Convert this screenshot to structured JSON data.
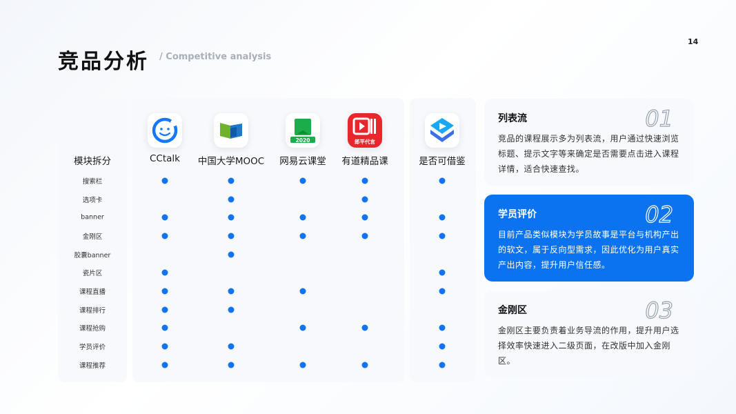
{
  "page_number": "14",
  "title": "竞品分析",
  "subtitle": "/ Competitive analysis",
  "row_header": "模块拆分",
  "columns": [
    {
      "label": "CCtalk",
      "icon": "cctalk-icon"
    },
    {
      "label": "中国大学MOOC",
      "icon": "mooc-icon"
    },
    {
      "label": "网易云课堂",
      "icon": "netease-study-icon",
      "badge": "2020"
    },
    {
      "label": "有道精品课",
      "icon": "youdao-icon",
      "badge": "郎平代言"
    },
    {
      "label": "是否可借鉴",
      "icon": "reference-app-icon"
    }
  ],
  "rows": [
    {
      "label": "搜索栏",
      "marks": [
        true,
        true,
        true,
        true,
        true
      ]
    },
    {
      "label": "选项卡",
      "marks": [
        false,
        true,
        false,
        true,
        false
      ]
    },
    {
      "label": "banner",
      "marks": [
        true,
        true,
        true,
        true,
        true
      ]
    },
    {
      "label": "金刚区",
      "marks": [
        true,
        true,
        true,
        true,
        true
      ]
    },
    {
      "label": "胶囊banner",
      "marks": [
        false,
        true,
        false,
        false,
        false
      ]
    },
    {
      "label": "瓷片区",
      "marks": [
        true,
        false,
        false,
        false,
        true
      ]
    },
    {
      "label": "课程直播",
      "marks": [
        true,
        true,
        true,
        false,
        true
      ]
    },
    {
      "label": "课程排行",
      "marks": [
        true,
        true,
        false,
        false,
        false
      ]
    },
    {
      "label": "课程抢购",
      "marks": [
        true,
        false,
        true,
        true,
        true
      ]
    },
    {
      "label": "学员评价",
      "marks": [
        true,
        true,
        false,
        false,
        true
      ]
    },
    {
      "label": "课程推荐",
      "marks": [
        true,
        true,
        true,
        true,
        true
      ]
    }
  ],
  "cards": [
    {
      "num": "01",
      "title": "列表流",
      "body": "竞品的课程展示多为列表流，用户通过快速浏览标题、提示文字等来确定是否需要点击进入课程详情，适合快速查找。",
      "active": false
    },
    {
      "num": "02",
      "title": "学员评价",
      "body": "目前产品类似模块为学员故事是平台与机构产出的软文，属于反向型需求，因此优化为用户真实产出内容，提升用户信任感。",
      "active": true
    },
    {
      "num": "03",
      "title": "金刚区",
      "body": "金刚区主要负责着业务导流的作用，提升用户选择效率快速进入二级页面，在改版中加入金刚区。",
      "active": false
    }
  ],
  "colors": {
    "accent": "#1274f5",
    "card_active": "#0b73f0"
  }
}
